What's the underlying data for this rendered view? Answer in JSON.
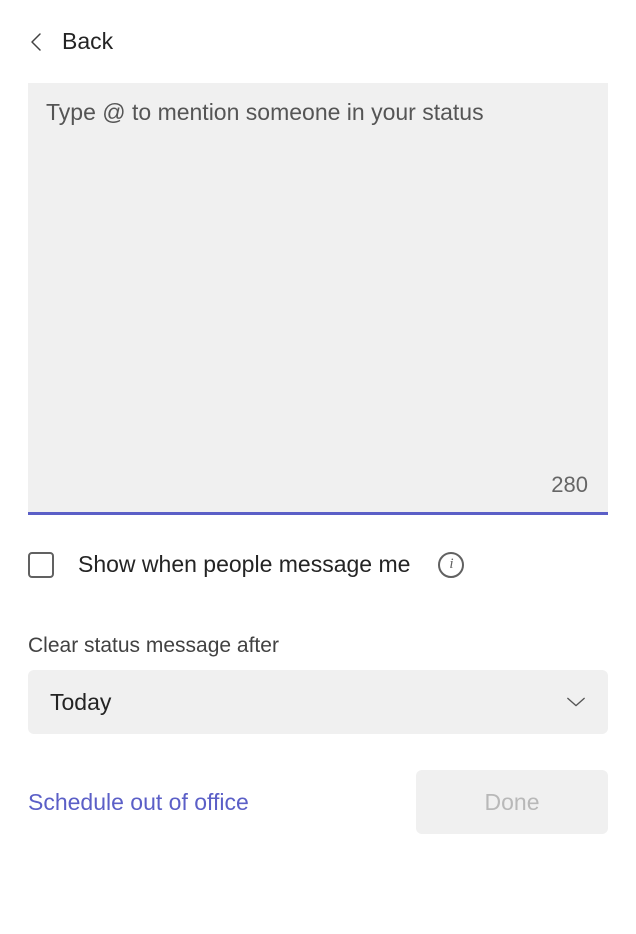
{
  "header": {
    "back_label": "Back"
  },
  "status_input": {
    "placeholder": "Type @ to mention someone in your status",
    "value": "",
    "char_remaining": "280"
  },
  "show_when_message": {
    "label": "Show when people message me",
    "checked": false
  },
  "clear_after": {
    "label": "Clear status message after",
    "selected": "Today"
  },
  "actions": {
    "schedule_label": "Schedule out of office",
    "done_label": "Done"
  },
  "colors": {
    "accent": "#5b5fc7"
  }
}
